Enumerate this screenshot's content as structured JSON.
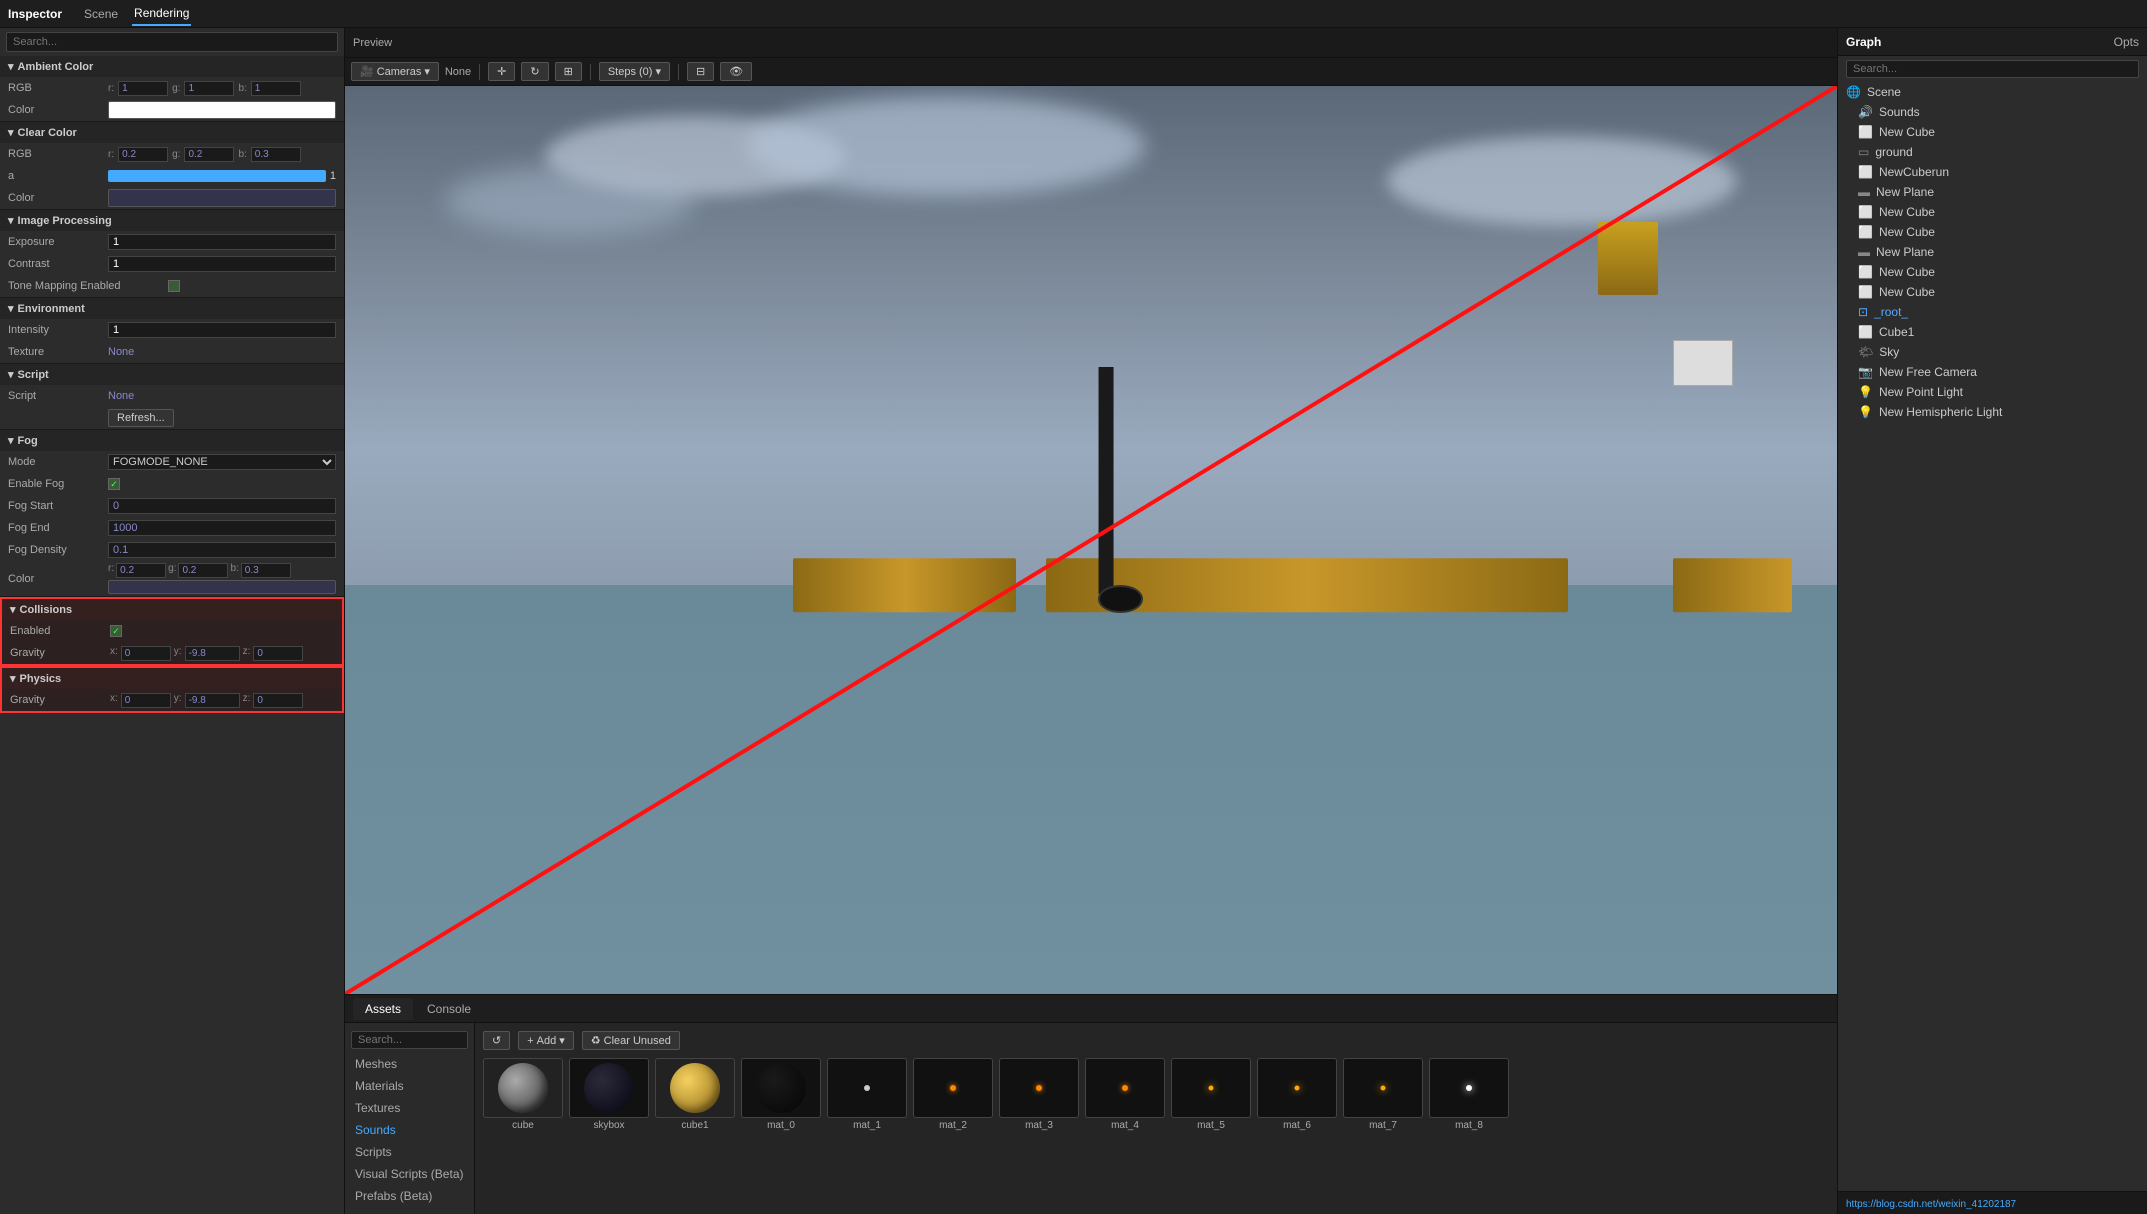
{
  "inspector": {
    "title": "Inspector",
    "tabs": [
      "Scene",
      "Rendering"
    ],
    "active_tab": "Rendering",
    "sections": {
      "ambient_color": {
        "label": "Ambient Color",
        "rgb": {
          "r": "1",
          "g": "1",
          "b": "1"
        },
        "color_label": "Color",
        "color_value": "#ffffff"
      },
      "clear_color": {
        "label": "Clear Color",
        "rgb": {
          "r": "0.2",
          "g": "0.2",
          "b": "0.3"
        },
        "a_label": "a",
        "a_value": "1",
        "color_label": "Color",
        "color_value": "#33334c"
      },
      "image_processing": {
        "label": "Image Processing",
        "exposure_label": "Exposure",
        "exposure_value": "1",
        "contrast_label": "Contrast",
        "contrast_value": "1",
        "tone_label": "Tone Mapping Enabled"
      },
      "environment": {
        "label": "Environment",
        "intensity_label": "Intensity",
        "intensity_value": "1",
        "texture_label": "Texture",
        "texture_value": "None"
      },
      "script": {
        "label": "Script",
        "script_label": "Script",
        "script_value": "None",
        "refresh_btn": "Refresh..."
      },
      "fog": {
        "label": "Fog",
        "mode_label": "Mode",
        "mode_value": "FOGMODE_NONE",
        "enable_label": "Enable Fog",
        "start_label": "Fog Start",
        "start_value": "0",
        "end_label": "Fog End",
        "end_value": "1000",
        "density_label": "Fog Density",
        "density_value": "0.1",
        "color_label": "Color",
        "fog_rgb": {
          "r": "0.2",
          "g": "0.2",
          "b": "0.3"
        },
        "fog_color_value": "#33334c"
      },
      "collisions": {
        "label": "Collisions",
        "enabled_label": "Enabled",
        "gravity_label": "Gravity",
        "grav_x": "0",
        "grav_y": "-9.8",
        "grav_z": "0"
      },
      "physics": {
        "label": "Physics",
        "gravity_label": "Gravity",
        "grav_x": "0",
        "grav_y": "-9.8",
        "grav_z": "0"
      }
    }
  },
  "preview": {
    "label": "Preview",
    "cameras_btn": "Cameras",
    "none_label": "None",
    "steps_btn": "Steps (0)"
  },
  "graph": {
    "title": "Graph",
    "search_placeholder": "Search...",
    "opts_label": "Opts",
    "items": [
      {
        "label": "Scene",
        "icon": "scene",
        "indent": 0
      },
      {
        "label": "Sounds",
        "icon": "sound",
        "indent": 1
      },
      {
        "label": "New Cube",
        "icon": "cube",
        "indent": 1
      },
      {
        "label": "ground",
        "icon": "ground",
        "indent": 1
      },
      {
        "label": "NewCuberun",
        "icon": "cube",
        "indent": 1
      },
      {
        "label": "New Plane",
        "icon": "plane",
        "indent": 1
      },
      {
        "label": "New Cube",
        "icon": "cube",
        "indent": 1
      },
      {
        "label": "New Cube",
        "icon": "cube",
        "indent": 1
      },
      {
        "label": "New Plane",
        "icon": "plane",
        "indent": 1
      },
      {
        "label": "New Cube",
        "icon": "cube",
        "indent": 1
      },
      {
        "label": "New Cube",
        "icon": "cube",
        "indent": 1
      },
      {
        "label": "_root_",
        "icon": "root",
        "indent": 1,
        "highlighted": true
      },
      {
        "label": "Cube1",
        "icon": "cube",
        "indent": 1
      },
      {
        "label": "Sky",
        "icon": "sky",
        "indent": 1
      },
      {
        "label": "New Free Camera",
        "icon": "camera",
        "indent": 1
      },
      {
        "label": "New Point Light",
        "icon": "light",
        "indent": 1
      },
      {
        "label": "New Hemispheric Light",
        "icon": "light",
        "indent": 1
      }
    ]
  },
  "assets": {
    "tabs": [
      "Assets",
      "Console"
    ],
    "active_tab": "Assets",
    "search_placeholder": "Search...",
    "add_btn": "Add",
    "clear_btn": "Clear Unused",
    "categories": [
      "Meshes",
      "Materials",
      "Textures",
      "Sounds",
      "Scripts",
      "Visual Scripts (Beta)",
      "Prefabs (Beta)"
    ],
    "active_category": "Sounds",
    "items": [
      {
        "label": "cube",
        "type": "mesh"
      },
      {
        "label": "skybox",
        "type": "material_dark"
      },
      {
        "label": "cube1",
        "type": "material_gold"
      },
      {
        "label": "mat_0",
        "type": "material_black"
      },
      {
        "label": "mat_1",
        "type": "material_black_dot"
      },
      {
        "label": "mat_2",
        "type": "material_black_dot"
      },
      {
        "label": "mat_3",
        "type": "material_black_dot"
      },
      {
        "label": "mat_4",
        "type": "material_black_dot"
      },
      {
        "label": "mat_5",
        "type": "material_dot2"
      },
      {
        "label": "mat_6",
        "type": "material_dot2"
      },
      {
        "label": "mat_7",
        "type": "material_dot2"
      },
      {
        "label": "mat_8",
        "type": "material_dot2"
      }
    ]
  },
  "url": "https://blog.csdn.net/weixin_41202187"
}
